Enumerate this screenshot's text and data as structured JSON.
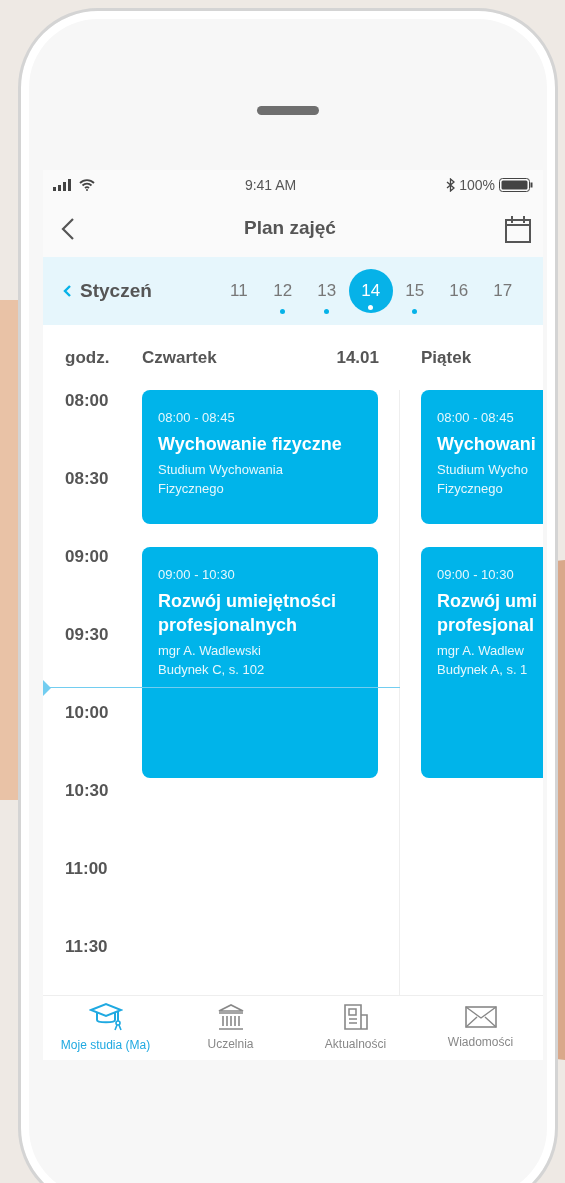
{
  "status_bar": {
    "time": "9:41 AM",
    "battery": "100%"
  },
  "header": {
    "title": "Plan zajęć"
  },
  "date_strip": {
    "month": "Styczeń",
    "days": [
      {
        "label": "11",
        "selected": false,
        "has_events": false
      },
      {
        "label": "12",
        "selected": false,
        "has_events": true
      },
      {
        "label": "13",
        "selected": false,
        "has_events": true
      },
      {
        "label": "14",
        "selected": true,
        "has_events": true
      },
      {
        "label": "15",
        "selected": false,
        "has_events": true
      },
      {
        "label": "16",
        "selected": false,
        "has_events": false
      },
      {
        "label": "17",
        "selected": false,
        "has_events": false
      }
    ]
  },
  "schedule": {
    "hours_heading": "godz.",
    "hours": [
      "08:00",
      "08:30",
      "09:00",
      "09:30",
      "10:00",
      "10:30",
      "11:00",
      "11:30"
    ],
    "days": [
      {
        "name": "Czwartek",
        "date": "14.01",
        "events": [
          {
            "time": "08:00 - 08:45",
            "title_lines": [
              "Wychowanie fizyczne"
            ],
            "details": [
              "Studium Wychowania",
              "Fizycznego"
            ]
          },
          {
            "time": "09:00 - 10:30",
            "title_lines": [
              "Rozwój umiejętności",
              "profesjonalnych"
            ],
            "details": [
              "mgr A. Wadlewski",
              "Budynek C, s. 102"
            ]
          }
        ]
      },
      {
        "name": "Piątek",
        "events": [
          {
            "time": "08:00 - 08:45",
            "title_lines": [
              "Wychowani"
            ],
            "details": [
              "Studium Wycho",
              "Fizycznego"
            ]
          },
          {
            "time": "09:00 - 10:30",
            "title_lines": [
              "Rozwój umi",
              "profesjonal"
            ],
            "details": [
              "mgr A. Wadlew",
              "Budynek A, s. 1"
            ]
          }
        ]
      }
    ]
  },
  "tab_bar": [
    {
      "label": "Moje studia (Ma)",
      "selected": true
    },
    {
      "label": "Uczelnia",
      "selected": false
    },
    {
      "label": "Aktualności",
      "selected": false
    },
    {
      "label": "Wiadomości",
      "selected": false
    }
  ]
}
